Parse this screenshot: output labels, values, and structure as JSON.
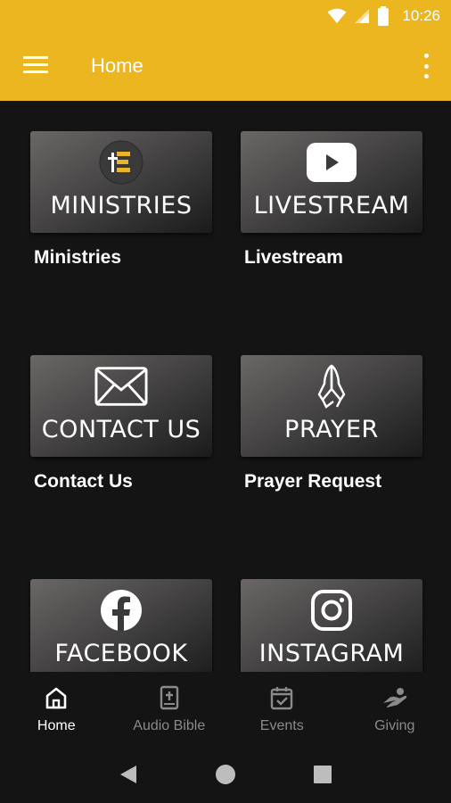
{
  "status": {
    "time": "10:26"
  },
  "header": {
    "title": "Home"
  },
  "tiles": [
    {
      "word": "MINISTRIES",
      "label": "Ministries",
      "icon": "ministries-logo-icon"
    },
    {
      "word": "LIVESTREAM",
      "label": "Livestream",
      "icon": "youtube-play-icon"
    },
    {
      "word": "CONTACT US",
      "label": "Contact Us",
      "icon": "envelope-icon"
    },
    {
      "word": "PRAYER",
      "label": "Prayer Request",
      "icon": "praying-hands-icon"
    },
    {
      "word": "FACEBOOK",
      "label": "",
      "icon": "facebook-icon"
    },
    {
      "word": "INSTAGRAM",
      "label": "",
      "icon": "instagram-icon"
    }
  ],
  "nav": {
    "items": [
      {
        "label": "Home",
        "icon": "home-icon",
        "active": true
      },
      {
        "label": "Audio Bible",
        "icon": "bible-icon",
        "active": false
      },
      {
        "label": "Events",
        "icon": "calendar-check-icon",
        "active": false
      },
      {
        "label": "Giving",
        "icon": "giving-hand-icon",
        "active": false
      }
    ]
  },
  "colors": {
    "accent": "#ECB620",
    "background": "#141414",
    "inactive": "#8a8a8a",
    "ministries_logo": "#ECB620"
  }
}
